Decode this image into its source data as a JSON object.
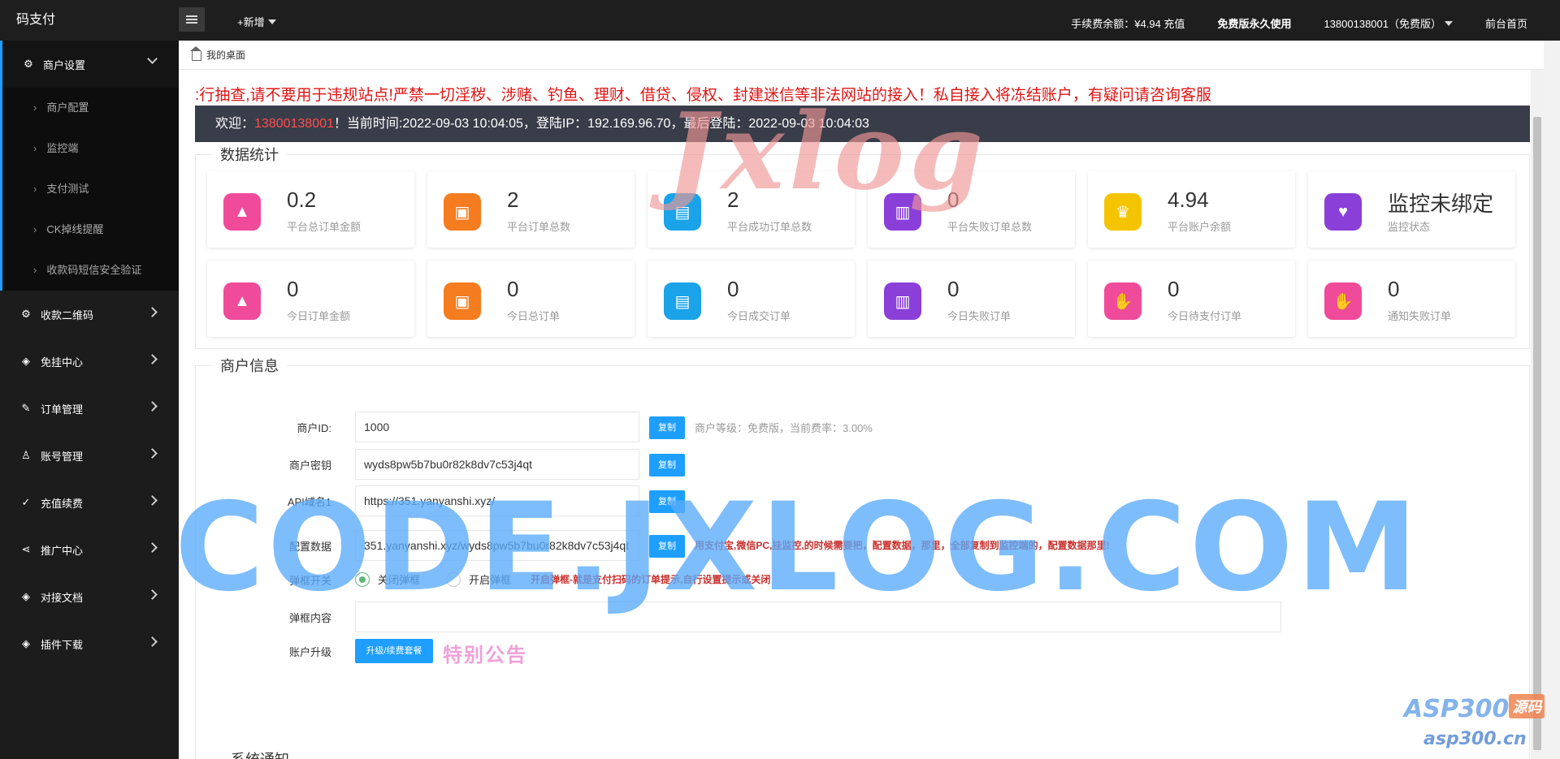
{
  "app": {
    "brand": "码支付",
    "add_new": "+新增"
  },
  "topbar": {
    "fee_balance": "手续费余额：¥4.94 充值",
    "plan": "免费版永久使用",
    "account": "13800138001（免费版）",
    "front_home": "前台首页"
  },
  "sidebar": {
    "groups": [
      {
        "label": "商户设置",
        "icon": "gear-icon",
        "open": true,
        "items": [
          "商户配置",
          "监控端",
          "支付测试",
          "CK掉线提醒",
          "收款码短信安全验证"
        ]
      },
      {
        "label": "收款二维码",
        "icon": "gear-icon"
      },
      {
        "label": "免挂中心",
        "icon": "cube-icon"
      },
      {
        "label": "订单管理",
        "icon": "edit-icon"
      },
      {
        "label": "账号管理",
        "icon": "users-icon"
      },
      {
        "label": "充值续费",
        "icon": "check-icon"
      },
      {
        "label": "推广中心",
        "icon": "share-icon"
      },
      {
        "label": "对接文档",
        "icon": "cube-icon"
      },
      {
        "label": "插件下载",
        "icon": "cube-icon"
      }
    ]
  },
  "tab": {
    "home": "我的桌面"
  },
  "notice": ":行抽查,请不要用于违规站点!严禁一切淫秽、涉赌、钓鱼、理财、借贷、侵权、封建迷信等非法网站的接入！私自接入将冻结账户，有疑问请咨询客服",
  "welcome": {
    "prefix": "欢迎：",
    "uid": "13800138001",
    "suffix": "！当前时间:2022-09-03 10:04:05，登陆IP：192.169.96.70，最后登陆：2022-09-03 10:04:03"
  },
  "stats": {
    "legend": "数据统计",
    "cards": [
      {
        "value": "0.2",
        "label": "平台总订单金额",
        "icon": "rocket-icon",
        "color": "#f04a9b"
      },
      {
        "value": "2",
        "label": "平台订单总数",
        "icon": "ticket-icon",
        "color": "#f57c1f"
      },
      {
        "value": "2",
        "label": "平台成功订单总数",
        "icon": "wallet-icon",
        "color": "#1aa3e8"
      },
      {
        "value": "0",
        "label": "平台失败订单总数",
        "icon": "jar-icon",
        "color": "#8a3fd9"
      },
      {
        "value": "4.94",
        "label": "平台账户余额",
        "icon": "crown-icon",
        "color": "#f5c400"
      },
      {
        "value": "监控未绑定",
        "label": "监控状态",
        "icon": "heart-icon",
        "color": "#8a3fd9"
      },
      {
        "value": "0",
        "label": "今日订单金额",
        "icon": "rocket-icon",
        "color": "#f04a9b"
      },
      {
        "value": "0",
        "label": "今日总订单",
        "icon": "ticket-icon",
        "color": "#f57c1f"
      },
      {
        "value": "0",
        "label": "今日成交订单",
        "icon": "wallet-icon",
        "color": "#1aa3e8"
      },
      {
        "value": "0",
        "label": "今日失败订单",
        "icon": "jar-icon",
        "color": "#8a3fd9"
      },
      {
        "value": "0",
        "label": "今日待支付订单",
        "icon": "hand-icon",
        "color": "#f04a9b"
      },
      {
        "value": "0",
        "label": "通知失败订单",
        "icon": "hand-icon",
        "color": "#f04a9b"
      }
    ]
  },
  "merchant": {
    "legend": "商户信息",
    "id_label": "商户ID:",
    "id_value": "1000",
    "copy": "复制",
    "level_hint": "商户等级：免费版，当前费率：3.00%",
    "key_label": "商户密钥",
    "key_value": "wyds8pw5b7bu0r82k8dv7c53j4qt",
    "api_label": "API域名1",
    "api_value": "https://351.yanyanshi.xyz/",
    "config_label": "配置数据",
    "config_value": "351.yanyanshi.xyz/wyds8pw5b7bu0r82k8dv7c53j4qt",
    "config_hint": "用支付宝,微信PC,挂监控,的时候需要把，配置数据，那里，全部复制到监控端的，配置数据那里!",
    "popup_label": "弹框开关",
    "popup_off": "关闭弹框",
    "popup_on": "开启弹框",
    "popup_hint": "开启弹框-就是支付扫码的订单提示,自行设置提示或关闭",
    "popup_content_label": "弹框内容",
    "popup_content_value": "",
    "upgrade_label": "账户升级",
    "upgrade_button": "升级/续费套餐",
    "special_notice": "特别公告"
  },
  "system_notice": "系统通知",
  "watermarks": {
    "jxlog": "Jxlog",
    "code": "CODE.JXLOG.COM",
    "asp": "ASP300",
    "asp_tag": "源码",
    "asp_url": "asp300.cn"
  }
}
